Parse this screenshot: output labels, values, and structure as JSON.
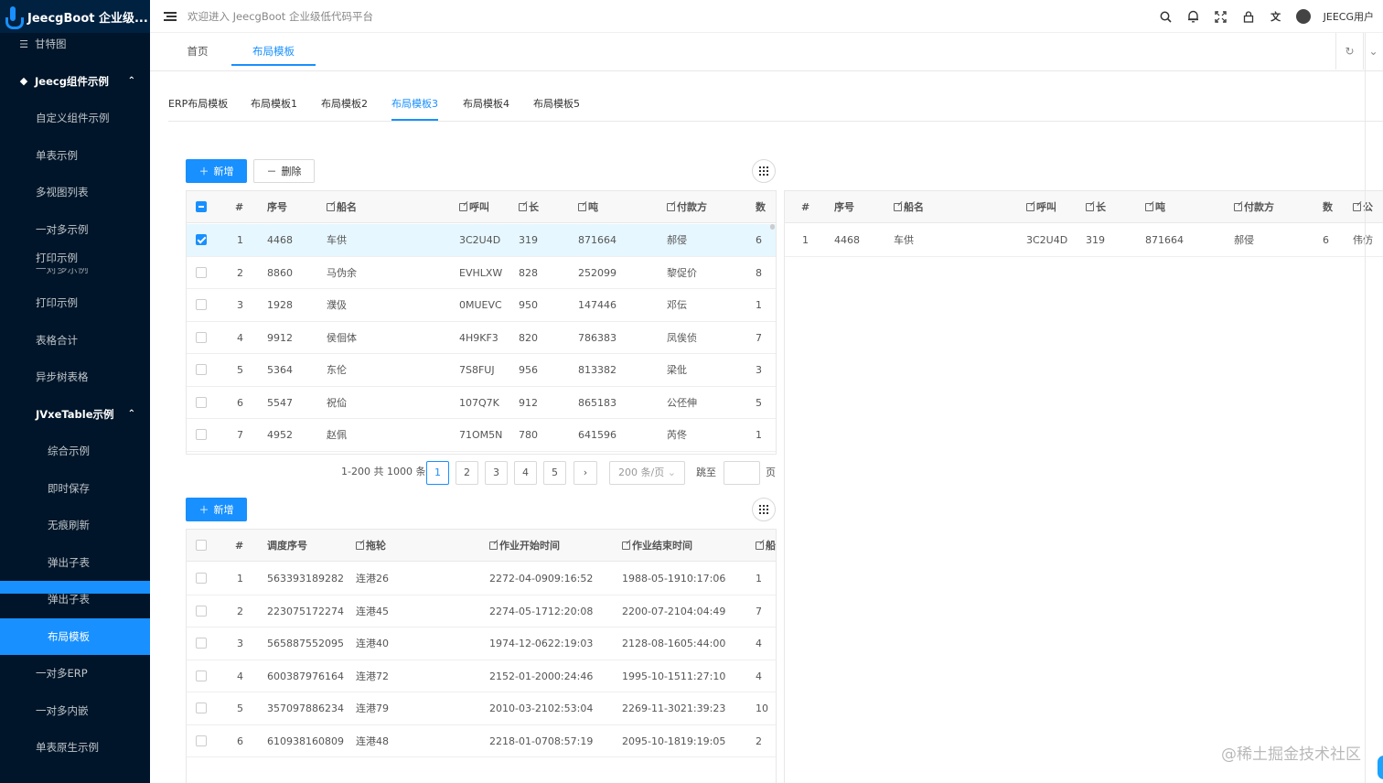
{
  "app": {
    "logo_text": "JeecgBoot 企业级...",
    "welcome": "欢迎进入 JeecgBoot 企业级低代码平台",
    "user": "JEECG用户",
    "accent": "#1890ff",
    "sidebar_bg": "#001529"
  },
  "sidebar": {
    "items": [
      {
        "label": "甘特图",
        "icon": "menu-icon"
      },
      {
        "label": "Jeecg组件示例",
        "icon": "gem-icon"
      },
      {
        "label": "自定义组件示例"
      },
      {
        "label": "单表示例"
      },
      {
        "label": "多视图列表"
      },
      {
        "label": "一对多示例"
      },
      {
        "label": "打印示例"
      },
      {
        "label": "一对多示例"
      },
      {
        "label": "打印示例"
      },
      {
        "label": "表格合计"
      },
      {
        "label": "异步树表格"
      },
      {
        "label": "JVxeTable示例"
      },
      {
        "label": "综合示例"
      },
      {
        "label": "即时保存"
      },
      {
        "label": "无痕刷新"
      },
      {
        "label": "弹出子表"
      },
      {
        "label": "弹出子表"
      },
      {
        "label": "布局模板"
      },
      {
        "label": "一对多ERP"
      },
      {
        "label": "一对多内嵌"
      },
      {
        "label": "单表原生示例"
      }
    ]
  },
  "tabs": [
    {
      "label": "首页"
    },
    {
      "label": "布局模板"
    }
  ],
  "subtabs": [
    {
      "label": "ERP布局模板"
    },
    {
      "label": "布局模板1"
    },
    {
      "label": "布局模板2"
    },
    {
      "label": "布局模板3"
    },
    {
      "label": "布局模板4"
    },
    {
      "label": "布局模板5"
    }
  ],
  "toolbar1": {
    "add_label": "新增",
    "delete_label": "删除"
  },
  "toolbar2": {
    "add_label": "新增"
  },
  "table1": {
    "columns": [
      "#",
      "序号",
      "船名",
      "呼叫",
      "长",
      "吨",
      "付款方",
      "数"
    ],
    "rows": [
      {
        "idx": "1",
        "seq": "4468",
        "ship": "车供",
        "call": "3C2U4D",
        "len": "319",
        "ton": "871664",
        "payer": "郝侵",
        "num": "6",
        "checked": true
      },
      {
        "idx": "2",
        "seq": "8860",
        "ship": "马伪余",
        "call": "EVHLXW",
        "len": "828",
        "ton": "252099",
        "payer": "黎促价",
        "num": "8",
        "checked": false
      },
      {
        "idx": "3",
        "seq": "1928",
        "ship": "濮伋",
        "call": "0MUEVC",
        "len": "950",
        "ton": "147446",
        "payer": "邓伝",
        "num": "1",
        "checked": false
      },
      {
        "idx": "4",
        "seq": "9912",
        "ship": "侯佪体",
        "call": "4H9KF3",
        "len": "820",
        "ton": "786383",
        "payer": "凤俟侦",
        "num": "7",
        "checked": false
      },
      {
        "idx": "5",
        "seq": "5364",
        "ship": "东伦",
        "call": "7S8FUJ",
        "len": "956",
        "ton": "813382",
        "payer": "梁仳",
        "num": "3",
        "checked": false
      },
      {
        "idx": "6",
        "seq": "5547",
        "ship": "祝佡",
        "call": "107Q7K",
        "len": "912",
        "ton": "865183",
        "payer": "公伾伸",
        "num": "5",
        "checked": false
      },
      {
        "idx": "7",
        "seq": "4952",
        "ship": "赵佩",
        "call": "71OM5N",
        "len": "780",
        "ton": "641596",
        "payer": "芮佟",
        "num": "1",
        "checked": false
      }
    ]
  },
  "table_right": {
    "columns": [
      "#",
      "序号",
      "船名",
      "呼叫",
      "长",
      "吨",
      "付款方",
      "数",
      "公"
    ],
    "rows": [
      {
        "idx": "1",
        "seq": "4468",
        "ship": "车供",
        "call": "3C2U4D",
        "len": "319",
        "ton": "871664",
        "payer": "郝侵",
        "num": "6",
        "extra": "伟仿"
      }
    ]
  },
  "pagination": {
    "total_text": "1-200 共 1000 条",
    "pages": [
      "1",
      "2",
      "3",
      "4",
      "5"
    ],
    "next": "›",
    "page_size": "200 条/页",
    "jump_label": "跳至",
    "page_unit": "页",
    "current": "1"
  },
  "table2": {
    "columns": [
      "#",
      "调度序号",
      "拖轮",
      "作业开始时间",
      "作业结束时间",
      "船"
    ],
    "rows": [
      {
        "idx": "1",
        "seq": "563393189282",
        "tug": "连港26",
        "start": "2272-04-0909:16:52",
        "end": "1988-05-1910:17:06",
        "n": "1"
      },
      {
        "idx": "2",
        "seq": "223075172274",
        "tug": "连港45",
        "start": "2274-05-1712:20:08",
        "end": "2200-07-2104:04:49",
        "n": "7"
      },
      {
        "idx": "3",
        "seq": "565887552095",
        "tug": "连港40",
        "start": "1974-12-0622:19:03",
        "end": "2128-08-1605:44:00",
        "n": "4"
      },
      {
        "idx": "4",
        "seq": "600387976164",
        "tug": "连港72",
        "start": "2152-01-2000:24:46",
        "end": "1995-10-1511:27:10",
        "n": "4"
      },
      {
        "idx": "5",
        "seq": "357097886234",
        "tug": "连港79",
        "start": "2010-03-2102:53:04",
        "end": "2269-11-3021:39:23",
        "n": "10"
      },
      {
        "idx": "6",
        "seq": "610938160809",
        "tug": "连港48",
        "start": "2218-01-0708:57:19",
        "end": "2095-10-1819:19:05",
        "n": "2"
      }
    ]
  },
  "watermark": "@稀土掘金技术社区"
}
